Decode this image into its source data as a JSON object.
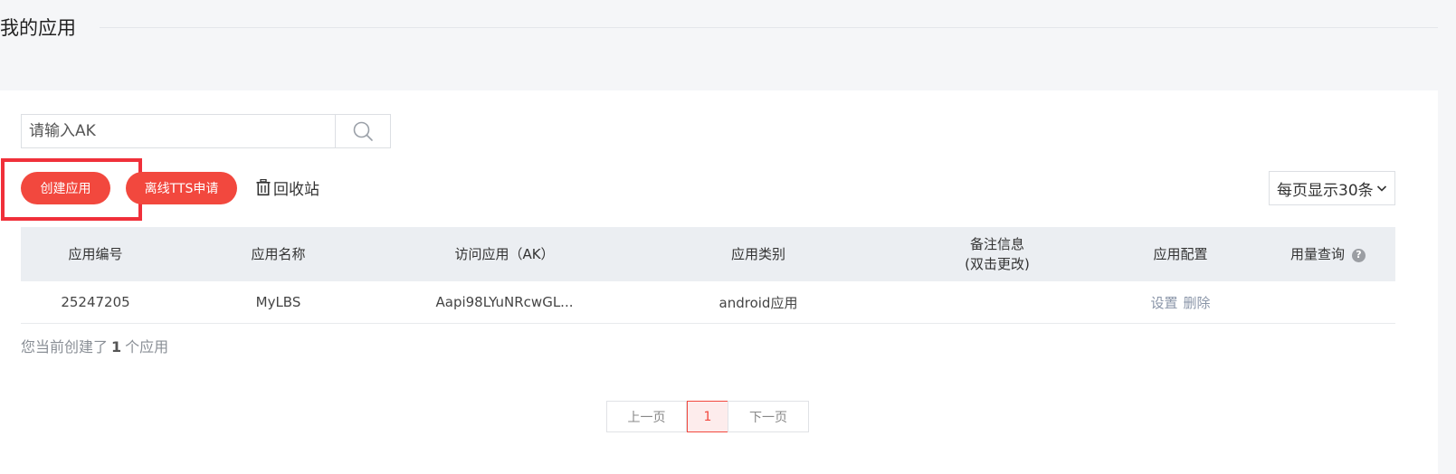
{
  "header": {
    "title": "我的应用"
  },
  "search": {
    "placeholder": "请输入AK"
  },
  "toolbar": {
    "create_label": "创建应用",
    "tts_label": "离线TTS申请",
    "recycle_label": "回收站",
    "page_size_label": "每页显示30条"
  },
  "table": {
    "columns": {
      "id": "应用编号",
      "name": "应用名称",
      "ak": "访问应用（AK）",
      "type": "应用类别",
      "note_line1": "备注信息",
      "note_line2": "(双击更改)",
      "config": "应用配置",
      "usage": "用量查询"
    },
    "rows": [
      {
        "id": "25247205",
        "name": "MyLBS",
        "ak": "Aapi98LYuNRcwGL...",
        "type": "android应用",
        "note": "",
        "settings": "设置",
        "delete": "删除"
      }
    ]
  },
  "summary": {
    "prefix": "您当前创建了",
    "count": "1",
    "suffix": "个应用"
  },
  "pagination": {
    "prev": "上一页",
    "current": "1",
    "next": "下一页"
  },
  "colors": {
    "accent": "#f2483e",
    "highlight_border": "#f0303a",
    "header_bg": "#ebeef2"
  },
  "icons": {
    "search": "search-icon",
    "trash": "trash-icon",
    "chevron": "chevron-down-icon",
    "help": "help-icon"
  }
}
